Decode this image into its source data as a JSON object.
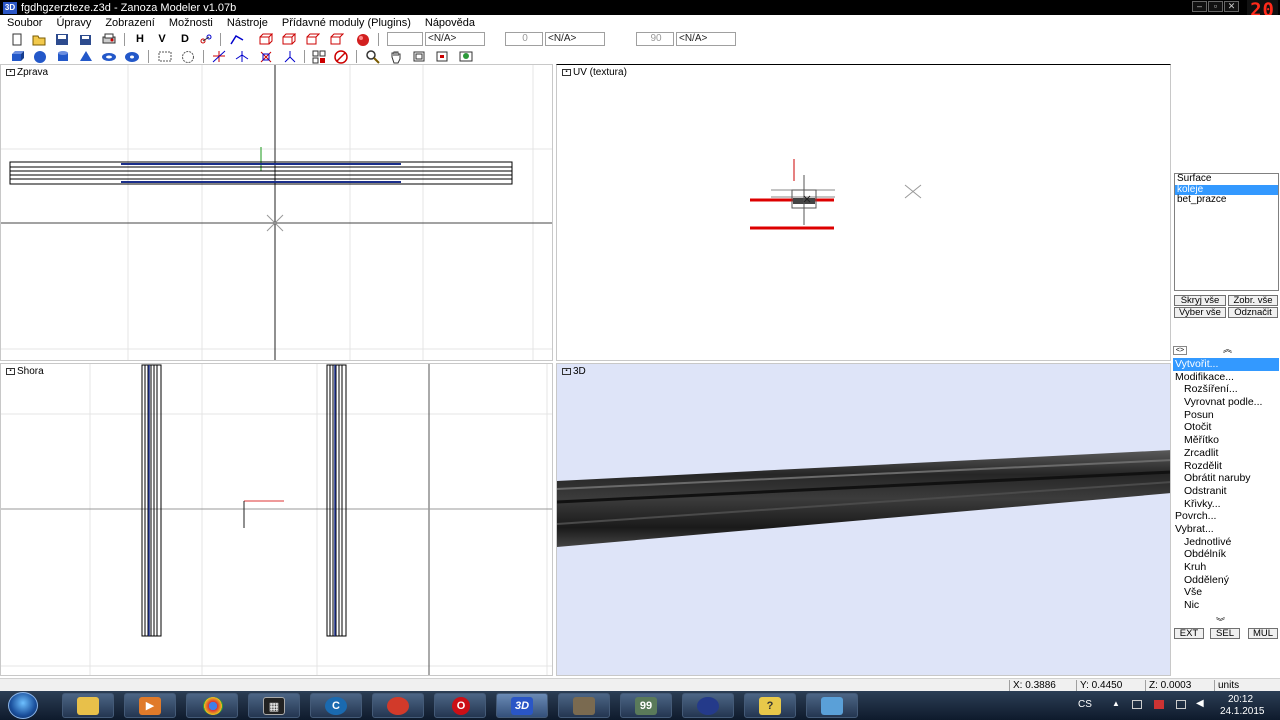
{
  "window": {
    "title": "fgdhgzerzteze.z3d - Zanoza Modeler v1.07b",
    "app_icon": "3D",
    "recording_counter": "20"
  },
  "menu": [
    "Soubor",
    "Úpravy",
    "Zobrazení",
    "Možnosti",
    "Nástroje",
    "Přídavné moduly (Plugins)",
    "Nápověda"
  ],
  "toolbar": {
    "axis_h": "H",
    "axis_v": "V",
    "axis_d": "D",
    "field1": "<N/A>",
    "spinner2": "0",
    "field2": "<N/A>",
    "spinner3": "90",
    "field3": "<N/A>"
  },
  "viewports": {
    "right": "Zprava",
    "uv": "UV (textura)",
    "top": "Shora",
    "view3d": "3D"
  },
  "surfaces": {
    "items": [
      {
        "label": "Surface",
        "selected": false
      },
      {
        "label": "koleje",
        "selected": true
      },
      {
        "label": "bet_prazce",
        "selected": false
      }
    ],
    "hide_all": "Skryj vše",
    "show_all": "Zobr. vše",
    "select_all": "Vyber vše",
    "deselect": "Odznačit"
  },
  "operations": {
    "head_left": "<>",
    "items": [
      {
        "label": "Vytvořit...",
        "level": 0,
        "selected": true
      },
      {
        "label": "Modifikace...",
        "level": 0,
        "selected": false
      },
      {
        "label": "Rozšíření...",
        "level": 1,
        "selected": false
      },
      {
        "label": "Vyrovnat podle...",
        "level": 1,
        "selected": false
      },
      {
        "label": "Posun",
        "level": 1,
        "selected": false
      },
      {
        "label": "Otočit",
        "level": 1,
        "selected": false
      },
      {
        "label": "Měřítko",
        "level": 1,
        "selected": false
      },
      {
        "label": "Zrcadlit",
        "level": 1,
        "selected": false
      },
      {
        "label": "Rozdělit",
        "level": 1,
        "selected": false
      },
      {
        "label": "Obrátit naruby",
        "level": 1,
        "selected": false
      },
      {
        "label": "Odstranit",
        "level": 1,
        "selected": false
      },
      {
        "label": "Křivky...",
        "level": 1,
        "selected": false
      },
      {
        "label": "Povrch...",
        "level": 0,
        "selected": false
      },
      {
        "label": "Vybrat...",
        "level": 0,
        "selected": false
      },
      {
        "label": "Jednotlivé",
        "level": 1,
        "selected": false
      },
      {
        "label": "Obdélník",
        "level": 1,
        "selected": false
      },
      {
        "label": "Kruh",
        "level": 1,
        "selected": false
      },
      {
        "label": "Oddělený",
        "level": 1,
        "selected": false
      },
      {
        "label": "Vše",
        "level": 1,
        "selected": false
      },
      {
        "label": "Nic",
        "level": 1,
        "selected": false
      }
    ],
    "mode_ext": "EXT",
    "mode_sel": "SEL",
    "mode_mul": "MUL"
  },
  "status": {
    "x": "X: 0.3886",
    "y": "Y: 0.4450",
    "z": "Z: 0.0003",
    "units": "units"
  },
  "taskbar": {
    "lang": "CS",
    "time": "20:12",
    "date": "24.1.2015",
    "badge_99": "99"
  },
  "colors": {
    "selection": "#3399ff",
    "viewport3d_bg": "#dee4f8",
    "uv_highlight": "#dd0000"
  }
}
